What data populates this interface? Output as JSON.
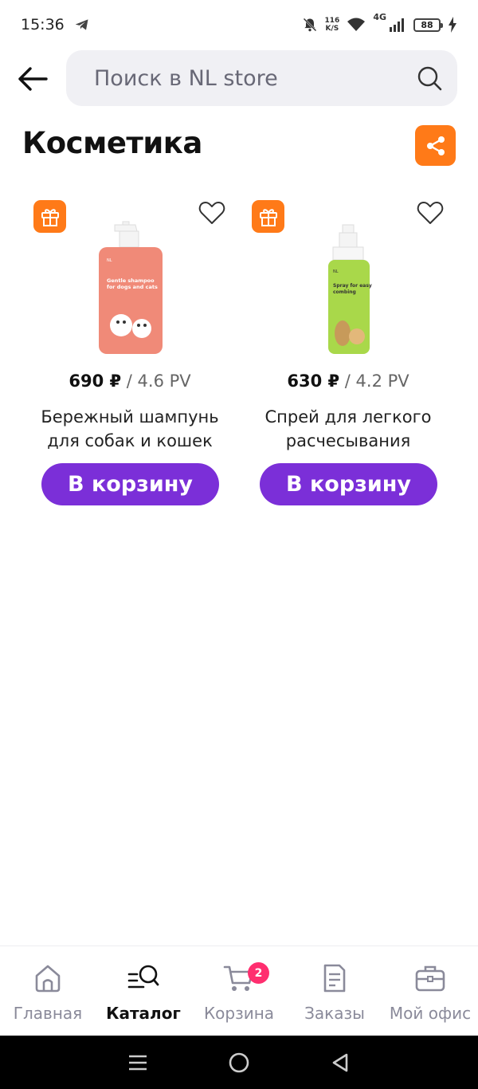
{
  "status_bar": {
    "time": "15:36",
    "net_speed_value": "116",
    "net_speed_unit": "K/S",
    "network_type": "4G",
    "battery": "88"
  },
  "search": {
    "placeholder": "Поиск в NL store"
  },
  "page": {
    "title": "Косметика"
  },
  "products": [
    {
      "price": "690 ₽",
      "pv": " / 4.6 PV",
      "name_line1": "Бережный шампунь",
      "name_line2": "для собак и кошек",
      "button_label": "В корзину",
      "bottle_label": "Gentle shampoo for dogs and cats",
      "bottle_color": "#f08a78"
    },
    {
      "price": "630 ₽",
      "pv": " / 4.2 PV",
      "name_line1": "Спрей для легкого",
      "name_line2": "расчесывания",
      "button_label": "В корзину",
      "bottle_label": "Spray for easy combing",
      "bottle_color": "#a9d84a"
    }
  ],
  "bottom_nav": {
    "items": [
      {
        "label": "Главная",
        "icon": "home-icon"
      },
      {
        "label": "Каталог",
        "icon": "catalog-search-icon"
      },
      {
        "label": "Корзина",
        "icon": "cart-icon",
        "badge": "2"
      },
      {
        "label": "Заказы",
        "icon": "orders-icon"
      },
      {
        "label": "Мой офис",
        "icon": "briefcase-icon"
      }
    ]
  },
  "colors": {
    "accent_orange": "#ff7a18",
    "button_purple": "#7b2fd8",
    "badge_pink": "#ff2e6f"
  }
}
